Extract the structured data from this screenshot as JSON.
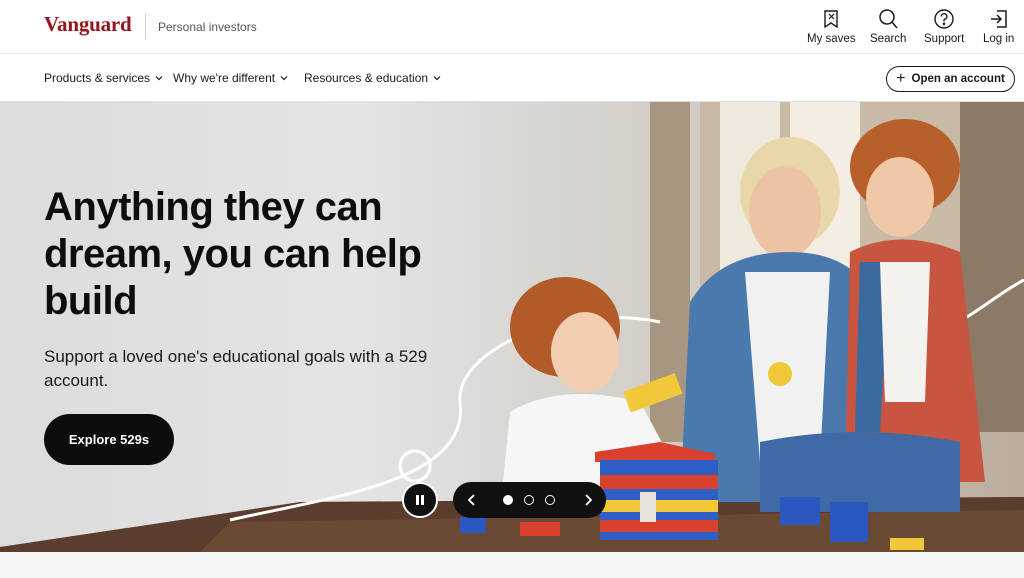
{
  "brand": {
    "name": "Vanguard",
    "segment": "Personal investors",
    "color": "#96151d"
  },
  "utility": [
    {
      "label": "My saves",
      "icon": "bookmark-icon"
    },
    {
      "label": "Search",
      "icon": "search-icon"
    },
    {
      "label": "Support",
      "icon": "help-icon"
    },
    {
      "label": "Log in",
      "icon": "login-icon"
    }
  ],
  "nav": {
    "items": [
      {
        "label": "Products & services"
      },
      {
        "label": "Why we're different"
      },
      {
        "label": "Resources & education"
      }
    ],
    "open_account_label": "Open an account"
  },
  "hero": {
    "headline": "Anything they can dream, you can help build",
    "subtext": "Support a loved one's educational goals with a 529 account.",
    "cta_label": "Explore 529s",
    "carousel": {
      "slide_count": 3,
      "active_slide": 1
    }
  },
  "colors": {
    "cta_bg": "#0d0d0d",
    "text": "#1a1a1a"
  }
}
